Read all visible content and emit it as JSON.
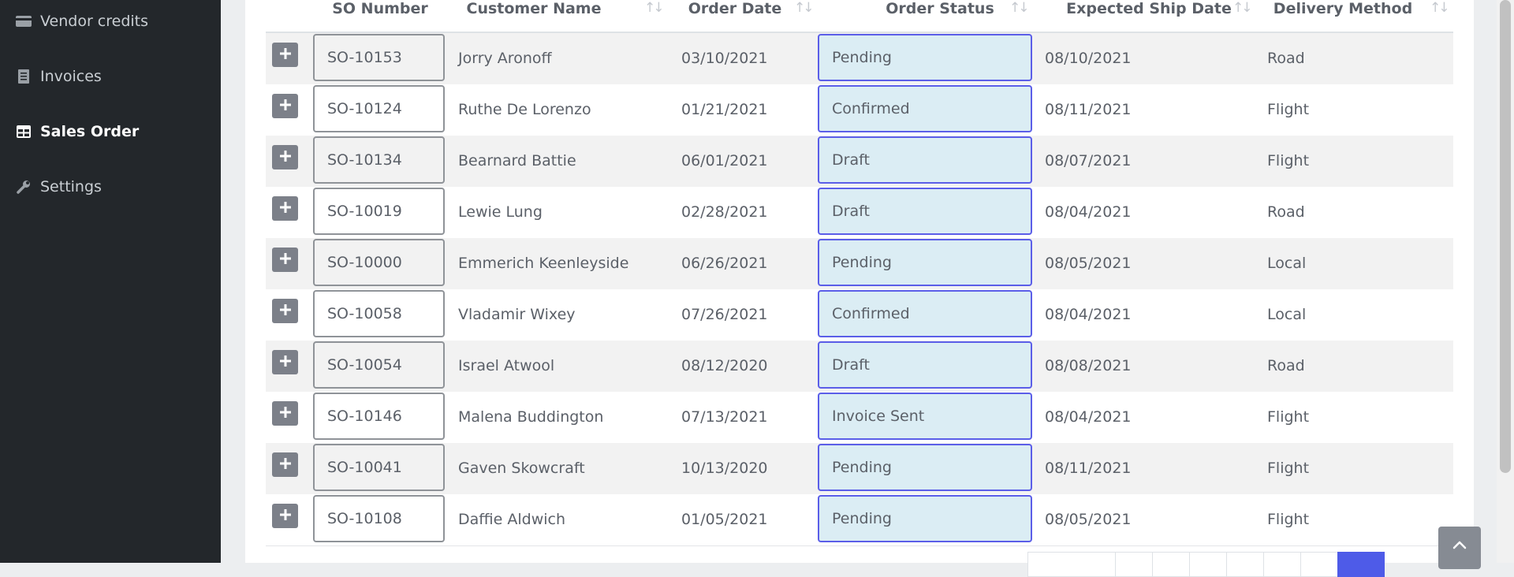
{
  "sidebar": {
    "items": [
      {
        "label": "Vendor credits",
        "icon": "credit-card-icon",
        "active": false
      },
      {
        "label": "Invoices",
        "icon": "receipt-icon",
        "active": false
      },
      {
        "label": "Sales Order",
        "icon": "table-icon",
        "active": true
      },
      {
        "label": "Settings",
        "icon": "wrench-icon",
        "active": false
      }
    ]
  },
  "table": {
    "headers": {
      "so_number": "SO Number",
      "customer_name": "Customer Name",
      "order_date": "Order Date",
      "order_status": "Order Status",
      "expected_ship_date": "Expected Ship Date",
      "delivery_method": "Delivery Method"
    },
    "rows": [
      {
        "so": "SO-10153",
        "customer": "Jorry Aronoff",
        "order_date": "03/10/2021",
        "status": "Pending",
        "ship_date": "08/10/2021",
        "delivery": "Road"
      },
      {
        "so": "SO-10124",
        "customer": "Ruthe De Lorenzo",
        "order_date": "01/21/2021",
        "status": "Confirmed",
        "ship_date": "08/11/2021",
        "delivery": "Flight"
      },
      {
        "so": "SO-10134",
        "customer": "Bearnard Battie",
        "order_date": "06/01/2021",
        "status": "Draft",
        "ship_date": "08/07/2021",
        "delivery": "Flight"
      },
      {
        "so": "SO-10019",
        "customer": "Lewie Lung",
        "order_date": "02/28/2021",
        "status": "Draft",
        "ship_date": "08/04/2021",
        "delivery": "Road"
      },
      {
        "so": "SO-10000",
        "customer": "Emmerich Keenleyside",
        "order_date": "06/26/2021",
        "status": "Pending",
        "ship_date": "08/05/2021",
        "delivery": "Local"
      },
      {
        "so": "SO-10058",
        "customer": "Vladamir Wixey",
        "order_date": "07/26/2021",
        "status": "Confirmed",
        "ship_date": "08/04/2021",
        "delivery": "Local"
      },
      {
        "so": "SO-10054",
        "customer": "Israel Atwool",
        "order_date": "08/12/2020",
        "status": "Draft",
        "ship_date": "08/08/2021",
        "delivery": "Road"
      },
      {
        "so": "SO-10146",
        "customer": "Malena Buddington",
        "order_date": "07/13/2021",
        "status": "Invoice Sent",
        "ship_date": "08/04/2021",
        "delivery": "Flight"
      },
      {
        "so": "SO-10041",
        "customer": "Gaven Skowcraft",
        "order_date": "10/13/2020",
        "status": "Pending",
        "ship_date": "08/11/2021",
        "delivery": "Flight"
      },
      {
        "so": "SO-10108",
        "customer": "Daffie Aldwich",
        "order_date": "01/05/2021",
        "status": "Pending",
        "ship_date": "08/05/2021",
        "delivery": "Flight"
      }
    ]
  },
  "colors": {
    "sidebar_bg": "#23272b",
    "status_border": "#5b5ee8",
    "status_bg": "#dbedf4",
    "pager_active": "#4e5be8"
  }
}
